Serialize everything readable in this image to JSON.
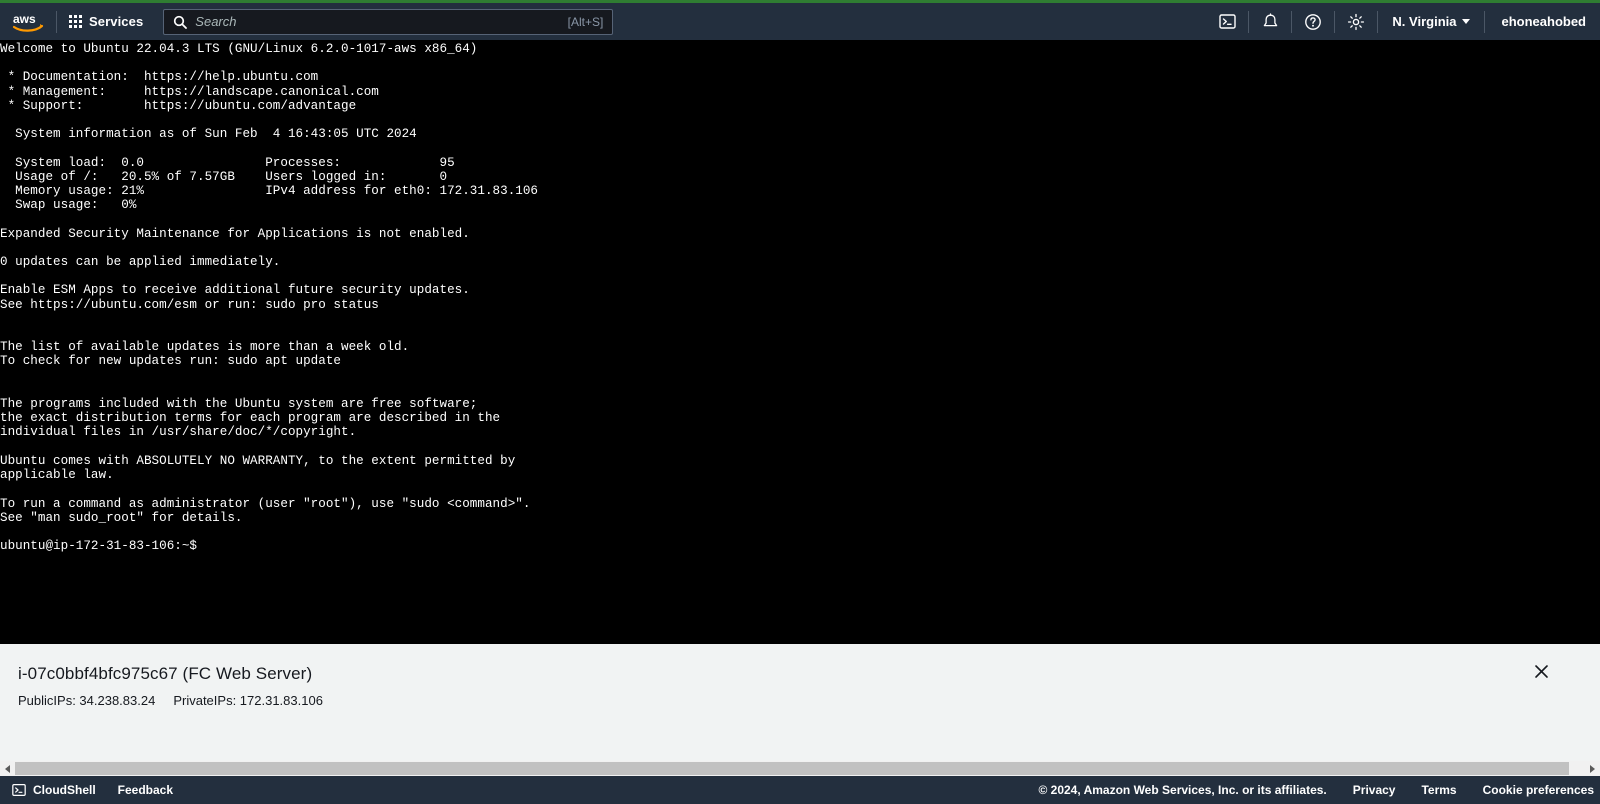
{
  "header": {
    "logo_alt": "aws",
    "services_label": "Services",
    "search": {
      "placeholder": "Search",
      "value": "",
      "shortcut": "[Alt+S]"
    },
    "cloudshell_icon": "cloudshell-icon",
    "notifications_icon": "bell-icon",
    "help_icon": "question-circle-icon",
    "settings_icon": "gear-icon",
    "region": "N. Virginia",
    "account": "ehoneahobed"
  },
  "terminal": {
    "lines": [
      "Welcome to Ubuntu 22.04.3 LTS (GNU/Linux 6.2.0-1017-aws x86_64)",
      "",
      " * Documentation:  https://help.ubuntu.com",
      " * Management:     https://landscape.canonical.com",
      " * Support:        https://ubuntu.com/advantage",
      "",
      "  System information as of Sun Feb  4 16:43:05 UTC 2024",
      "",
      "  System load:  0.0                Processes:             95",
      "  Usage of /:   20.5% of 7.57GB    Users logged in:       0",
      "  Memory usage: 21%                IPv4 address for eth0: 172.31.83.106",
      "  Swap usage:   0%",
      "",
      "Expanded Security Maintenance for Applications is not enabled.",
      "",
      "0 updates can be applied immediately.",
      "",
      "Enable ESM Apps to receive additional future security updates.",
      "See https://ubuntu.com/esm or run: sudo pro status",
      "",
      "",
      "The list of available updates is more than a week old.",
      "To check for new updates run: sudo apt update",
      "",
      "",
      "The programs included with the Ubuntu system are free software;",
      "the exact distribution terms for each program are described in the",
      "individual files in /usr/share/doc/*/copyright.",
      "",
      "Ubuntu comes with ABSOLUTELY NO WARRANTY, to the extent permitted by",
      "applicable law.",
      "",
      "To run a command as administrator (user \"root\"), use \"sudo <command>\".",
      "See \"man sudo_root\" for details.",
      ""
    ],
    "prompt": "ubuntu@ip-172-31-83-106:~$"
  },
  "info_panel": {
    "title": "i-07c0bbf4bfc975c67 (FC Web Server)",
    "public_ips": "PublicIPs: 34.238.83.24",
    "private_ips": "PrivateIPs: 172.31.83.106",
    "close_icon": "close-icon"
  },
  "footer": {
    "cloudshell_label": "CloudShell",
    "cloudshell_icon": "cloudshell-icon",
    "feedback_label": "Feedback",
    "copyright": "© 2024, Amazon Web Services, Inc. or its affiliates.",
    "privacy_label": "Privacy",
    "terms_label": "Terms",
    "cookie_label": "Cookie preferences"
  },
  "colors": {
    "header_bg": "#232f3e",
    "terminal_bg": "#000000",
    "panel_bg": "#f1f3f3",
    "accent_green": "#2f7d32"
  }
}
